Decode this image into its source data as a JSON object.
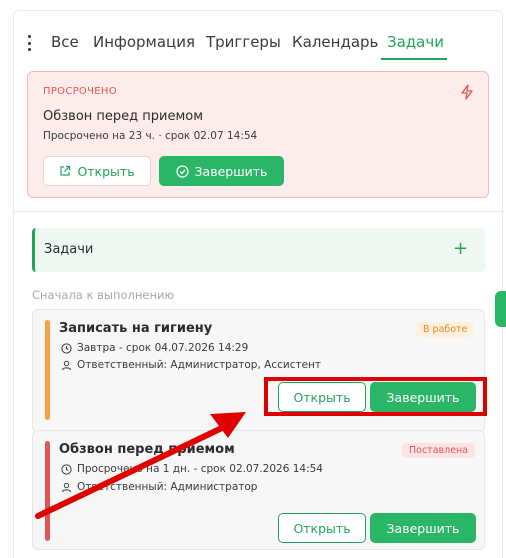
{
  "tabs": {
    "items": [
      "Все",
      "Информация",
      "Триггеры",
      "Календарь",
      "Задачи"
    ],
    "active_index": 4
  },
  "overdue": {
    "label": "ПРОСРОЧЕНО",
    "title": "Обзвон перед приемом",
    "subtitle": "Просрочено на 23 ч. · срок 02.07 14:54",
    "open_label": "Открыть",
    "done_label": "Завершить"
  },
  "tasks": {
    "header": "Задачи",
    "add_symbol": "+",
    "sort_label": "Сначала к выполнению",
    "items": [
      {
        "title": "Записать на гигиену",
        "badge": "В работе",
        "due": "Завтра - срок 04.07.2026 14:29",
        "responsible": "Ответственный: Администратор, Ассистент",
        "open_label": "Открыть",
        "done_label": "Завершить"
      },
      {
        "title": "Обзвон перед приемом",
        "badge": "Поставлена",
        "due": "Просрочено на 1 дн. - срок 02.07.2026 14:54",
        "responsible": "Ответственный: Администратор",
        "open_label": "Открыть",
        "done_label": "Завершить"
      }
    ]
  },
  "colors": {
    "accent": "#22a55b",
    "overdue": "#e05555",
    "in_progress": "#f5a142",
    "annotation": "#e00000"
  },
  "icons": {
    "menu": "kebab-menu-icon",
    "bolt": "lightning-icon",
    "open": "external-link-icon",
    "done": "check-circle-icon",
    "clock": "clock-icon",
    "user": "user-icon",
    "add": "plus-icon"
  }
}
